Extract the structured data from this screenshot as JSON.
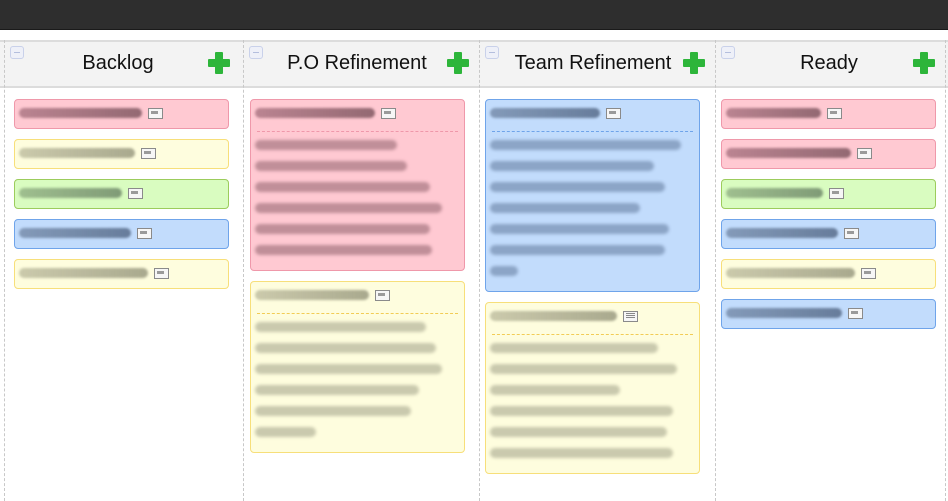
{
  "top_bar": {
    "color": "#2e2e2e"
  },
  "text_obfuscated": true,
  "columns": [
    {
      "title": "Backlog",
      "collapse_icon": "minus-square-icon",
      "add_icon": "green-plus-icon",
      "cards": [
        {
          "color": "pink",
          "title_width_frac": 0.57,
          "note_icon": "collapsed"
        },
        {
          "color": "yellow",
          "title_width_frac": 0.54,
          "note_icon": "collapsed"
        },
        {
          "color": "green",
          "title_width_frac": 0.48,
          "note_icon": "collapsed"
        },
        {
          "color": "blue",
          "title_width_frac": 0.52,
          "note_icon": "collapsed"
        },
        {
          "color": "yellow",
          "title_width_frac": 0.6,
          "note_icon": "collapsed"
        }
      ]
    },
    {
      "title": "P.O Refinement",
      "collapse_icon": "minus-square-icon",
      "add_icon": "green-plus-icon",
      "cards": [
        {
          "color": "pink",
          "title_width_frac": 0.56,
          "note_icon": "collapsed",
          "expanded": true,
          "body_lines": [
            0.7,
            0.75,
            0.86,
            0.92,
            0.86,
            0.87
          ]
        },
        {
          "color": "yellow",
          "title_width_frac": 0.53,
          "note_icon": "collapsed",
          "expanded": true,
          "body_lines": [
            0.84,
            0.89,
            0.92,
            0.81,
            0.77,
            0.3
          ]
        }
      ]
    },
    {
      "title": "Team Refinement",
      "collapse_icon": "minus-square-icon",
      "add_icon": "green-plus-icon",
      "cards": [
        {
          "color": "blue",
          "title_width_frac": 0.51,
          "note_icon": "collapsed",
          "expanded": true,
          "body_lines": [
            0.94,
            0.81,
            0.86,
            0.74,
            0.88,
            0.86,
            0.14
          ]
        },
        {
          "color": "yellow",
          "title_width_frac": 0.59,
          "note_icon": "expanded",
          "expanded": true,
          "body_lines": [
            0.83,
            0.92,
            0.64,
            0.9,
            0.87,
            0.9
          ]
        }
      ]
    },
    {
      "title": "Ready",
      "collapse_icon": "minus-square-icon",
      "add_icon": "green-plus-icon",
      "cards": [
        {
          "color": "pink",
          "title_width_frac": 0.44,
          "note_icon": "collapsed"
        },
        {
          "color": "pink",
          "title_width_frac": 0.58,
          "note_icon": "collapsed"
        },
        {
          "color": "green",
          "title_width_frac": 0.45,
          "note_icon": "collapsed"
        },
        {
          "color": "blue",
          "title_width_frac": 0.52,
          "note_icon": "collapsed"
        },
        {
          "color": "yellow",
          "title_width_frac": 0.6,
          "note_icon": "collapsed"
        },
        {
          "color": "blue",
          "title_width_frac": 0.54,
          "note_icon": "collapsed"
        }
      ]
    }
  ]
}
